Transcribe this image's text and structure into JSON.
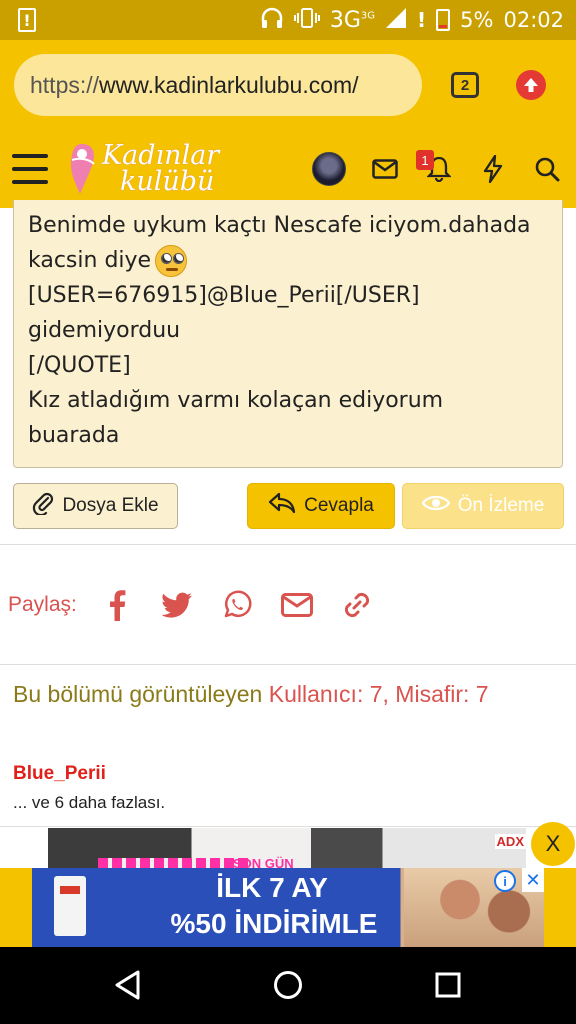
{
  "status_bar": {
    "left_icon": "sim-alert-icon",
    "network": "3G",
    "network_super": "3G",
    "alert": "!",
    "battery_percent": "5%",
    "time": "02:02"
  },
  "browser": {
    "url_scheme": "https://",
    "url_host": "www.kadinlarkulubu.com/",
    "tab_count": "2"
  },
  "site_header": {
    "logo_line1": "Kadınlar",
    "logo_line2": "kulübü",
    "notification_count": "1"
  },
  "quote": {
    "lines": [
      "Benimde uykum kaçtı Nescafe iciyom.dahada",
      "kacsin diye",
      "[USER=676915]@Blue_Perii[/USER]",
      "gidemiyorduu",
      "[/QUOTE]",
      "Kız atladığım varmı kolaçan ediyorum",
      "buarada"
    ]
  },
  "actions": {
    "attach_label": "Dosya Ekle",
    "reply_label": "Cevapla",
    "preview_label": "Ön İzleme"
  },
  "share": {
    "label": "Paylaş:"
  },
  "viewers": {
    "prefix": "Bu bölümü görüntüleyen",
    "count_text": "Kullanıcı: 7, Misafir: 7",
    "user": "Blue_Perii",
    "more": "... ve 6 daha fazlası."
  },
  "ads": {
    "top_text": "SON GÜN",
    "adx": "ADX",
    "close": "X",
    "banner_line1": "İLK 7 AY",
    "banner_line2": "%50 İNDİRİMLE",
    "info": "i",
    "banner_close": "✕"
  },
  "colors": {
    "brand_yellow": "#f5c200",
    "accent_red": "#d9534f",
    "quote_bg": "#fbf0cf",
    "heading_olive": "#8a7a1a"
  }
}
